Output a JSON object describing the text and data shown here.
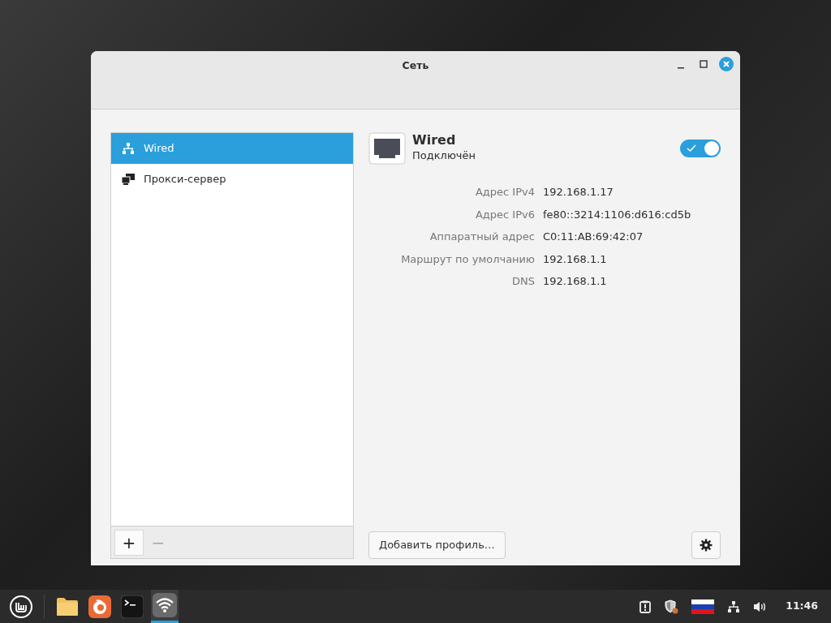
{
  "window": {
    "title": "Сеть"
  },
  "sidebar": {
    "items": [
      {
        "label": "Wired",
        "kind": "wired",
        "selected": true
      },
      {
        "label": "Прокси-сервер",
        "kind": "proxy",
        "selected": false
      }
    ],
    "add_button": {
      "label": "+",
      "disabled": false
    },
    "remove_button": {
      "label": "−",
      "disabled": true
    }
  },
  "device": {
    "name": "Wired",
    "status": "Подключён",
    "on": true
  },
  "details": [
    {
      "label": "Адрес IPv4",
      "value": "192.168.1.17"
    },
    {
      "label": "Адрес IPv6",
      "value": "fe80::3214:1106:d616:cd5b"
    },
    {
      "label": "Аппаратный адрес",
      "value": "C0:11:AB:69:42:07"
    },
    {
      "label": "Маршрут по умолчанию",
      "value": "192.168.1.1"
    },
    {
      "label": "DNS",
      "value": "192.168.1.1"
    }
  ],
  "add_profile_button": "Добавить профиль…",
  "taskbar": {
    "apps": [
      {
        "kind": "files",
        "selected": false
      },
      {
        "kind": "browser",
        "selected": false
      },
      {
        "kind": "terminal",
        "selected": false
      },
      {
        "kind": "network",
        "selected": true
      }
    ],
    "clock": "11:46"
  }
}
